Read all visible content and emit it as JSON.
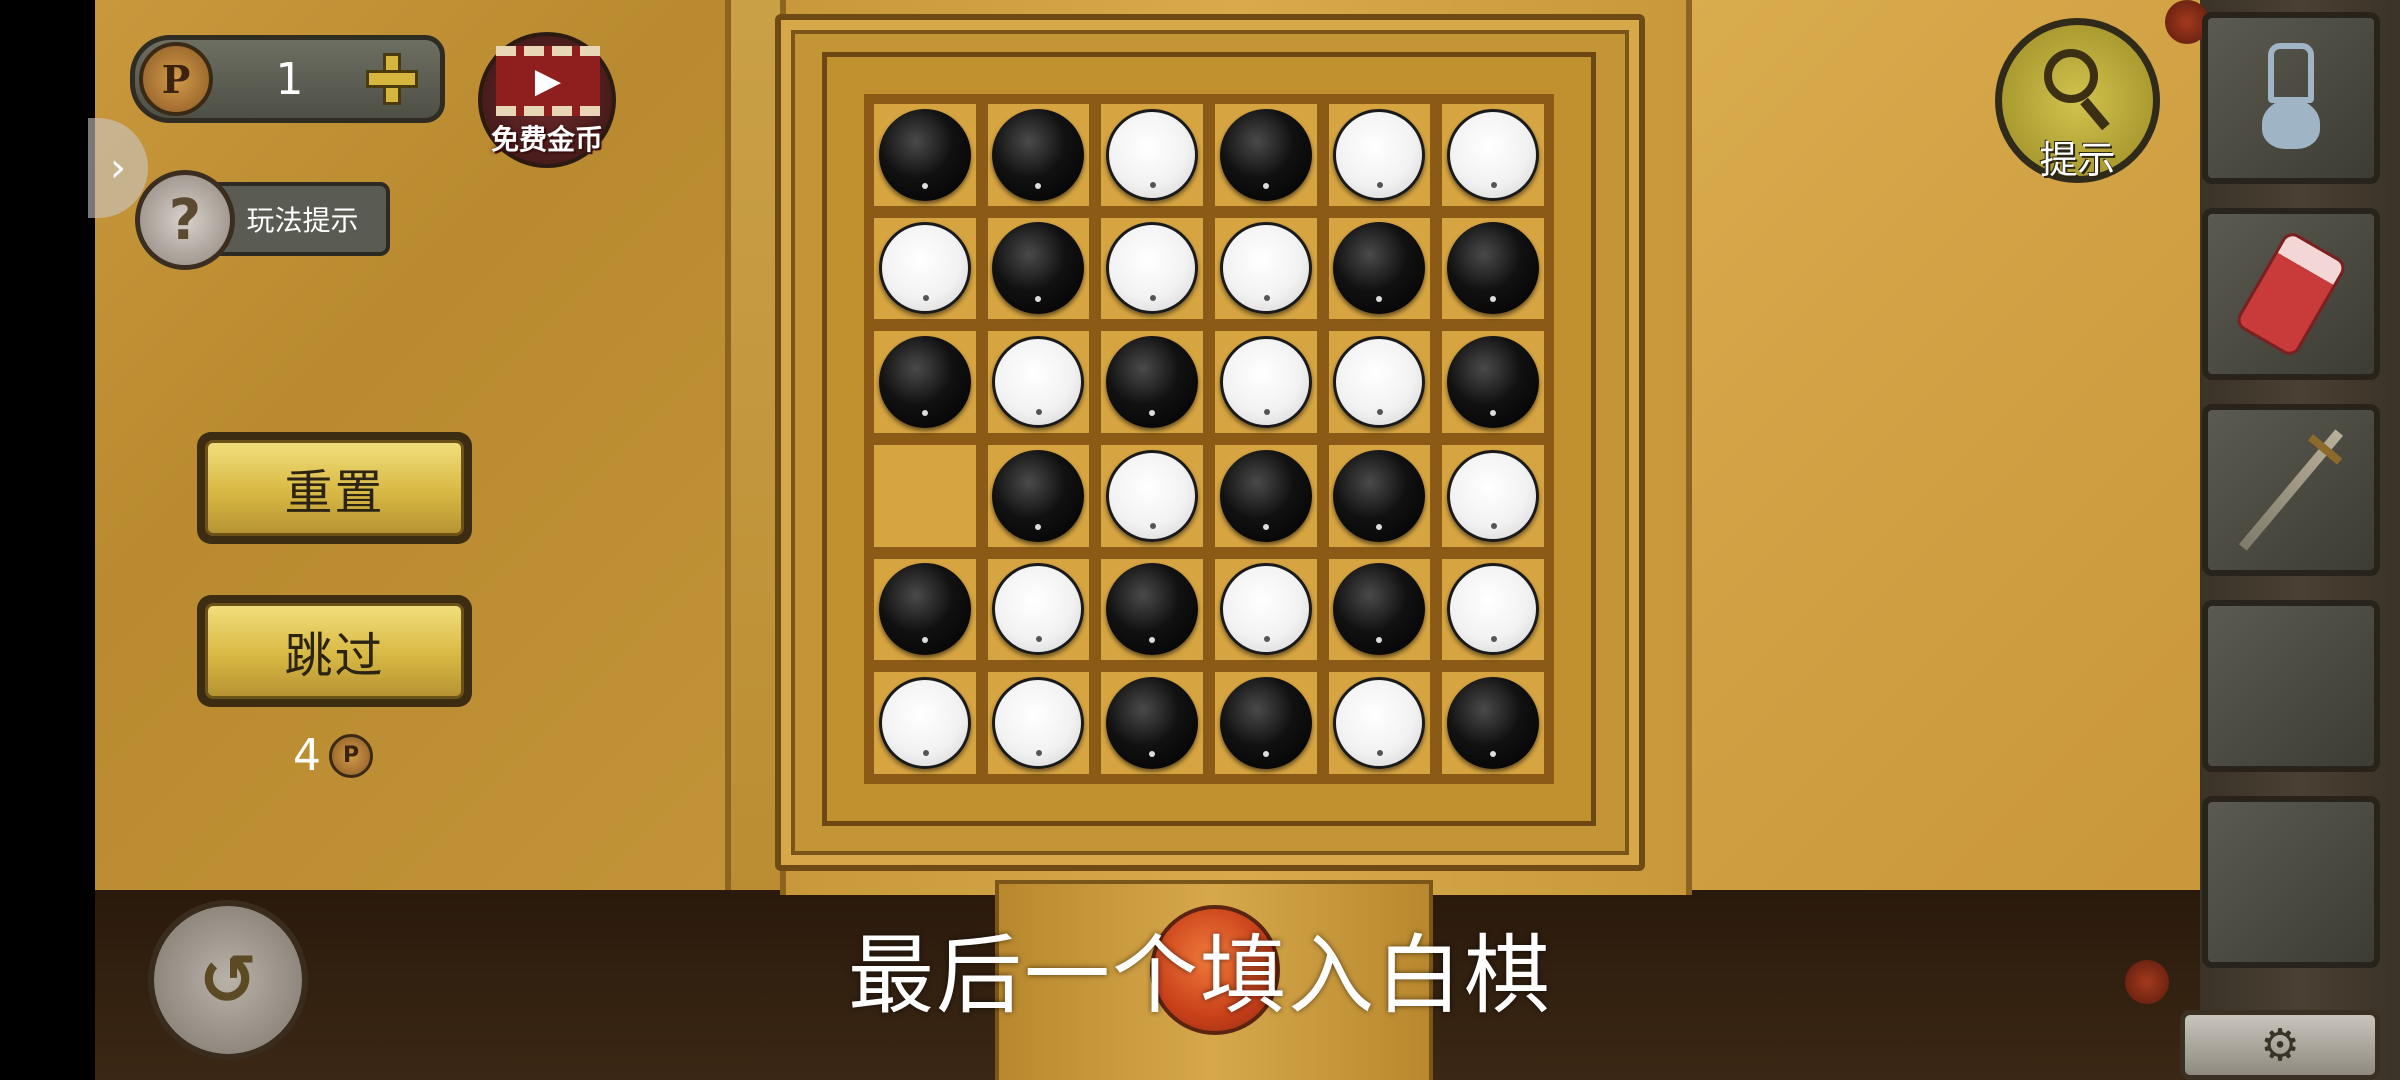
{
  "currency": {
    "count": "1",
    "coin_symbol": "P"
  },
  "video_reward": {
    "label": "免费金币"
  },
  "help": {
    "label": "玩法提示",
    "icon_symbol": "?"
  },
  "buttons": {
    "reset": "重置",
    "skip": "跳过"
  },
  "skip_cost": {
    "amount": "4",
    "coin_symbol": "P"
  },
  "hint": {
    "label": "提示"
  },
  "subtitle": "最后一个填入白棋",
  "board": {
    "rows": [
      [
        "black",
        "black",
        "white",
        "black",
        "white",
        "white"
      ],
      [
        "white",
        "black",
        "white",
        "white",
        "black",
        "black"
      ],
      [
        "black",
        "white",
        "black",
        "white",
        "white",
        "black"
      ],
      [
        "empty",
        "black",
        "white",
        "black",
        "black",
        "white"
      ],
      [
        "black",
        "white",
        "black",
        "white",
        "black",
        "white"
      ],
      [
        "white",
        "white",
        "black",
        "black",
        "white",
        "black"
      ]
    ]
  },
  "inventory": {
    "slots": [
      {
        "item": "can-opener-icon"
      },
      {
        "item": "red-bottle-icon"
      },
      {
        "item": "sword-icon"
      },
      {
        "item": ""
      },
      {
        "item": ""
      }
    ]
  },
  "icons": {
    "side_tab": "›",
    "back": "↺",
    "settings": "⚙",
    "play": "▶"
  }
}
